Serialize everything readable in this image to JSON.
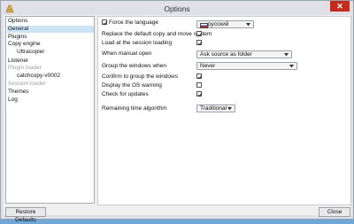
{
  "window": {
    "title": "Options",
    "close_glyph": "✕"
  },
  "tree": {
    "items": [
      {
        "label": "Options"
      },
      {
        "label": "General"
      },
      {
        "label": "Plugins"
      },
      {
        "label": "Copy engine"
      },
      {
        "label": "Ultracopier"
      },
      {
        "label": "Listener"
      },
      {
        "label": "Plugin loader"
      },
      {
        "label": "catchcopy-v0002"
      },
      {
        "label": "Session loader"
      },
      {
        "label": "Themes"
      },
      {
        "label": "Log"
      }
    ],
    "selected": "General"
  },
  "general": {
    "force_language": {
      "label": "Force the language",
      "checked": true
    },
    "language_combo": {
      "value": "русский"
    },
    "replace_default": {
      "label": "Replace the default copy and move system",
      "checked": true
    },
    "load_session": {
      "label": "Load at the session loading",
      "checked": true
    },
    "manual_open": {
      "label": "When manual open",
      "value": "Ask source as folder"
    },
    "group_windows": {
      "label": "Group the windows when",
      "value": "Never"
    },
    "confirm_group": {
      "label": "Confirm to group the windows",
      "checked": true
    },
    "os_warning": {
      "label": "Display the OS warning",
      "checked": false
    },
    "check_updates": {
      "label": "Check for updates",
      "checked": true
    },
    "time_algorithm": {
      "label": "Remaining time algorithm",
      "value": "Traditional"
    }
  },
  "buttons": {
    "restore_defaults": "Restore Defaults",
    "close": "Close"
  },
  "icons": [
    "app-icon",
    "close-icon",
    "russian-flag-icon",
    "chevron-down-icon",
    "checkmark-icon"
  ]
}
